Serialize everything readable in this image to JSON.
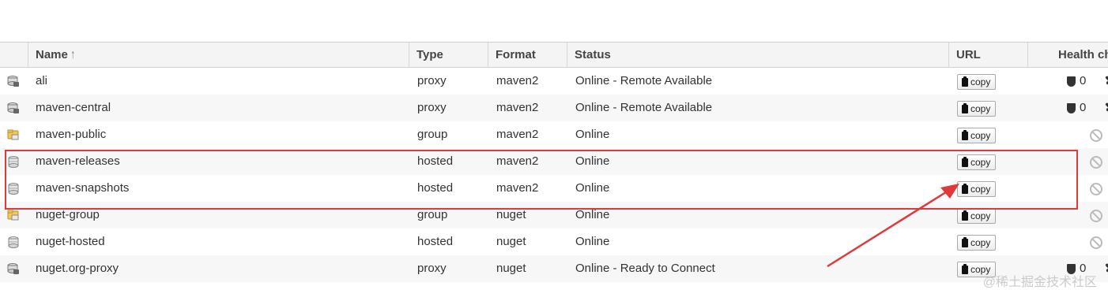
{
  "columns": {
    "name": "Name",
    "type": "Type",
    "format": "Format",
    "status": "Status",
    "url": "URL",
    "health": "Health ch"
  },
  "copy_label": "copy",
  "rows": [
    {
      "name": "ali",
      "type": "proxy",
      "format": "maven2",
      "status": "Online - Remote Available",
      "health": "0",
      "icon": "proxy-repo-icon"
    },
    {
      "name": "maven-central",
      "type": "proxy",
      "format": "maven2",
      "status": "Online - Remote Available",
      "health": "0",
      "icon": "proxy-repo-icon"
    },
    {
      "name": "maven-public",
      "type": "group",
      "format": "maven2",
      "status": "Online",
      "health": "",
      "icon": "group-repo-icon"
    },
    {
      "name": "maven-releases",
      "type": "hosted",
      "format": "maven2",
      "status": "Online",
      "health": "",
      "icon": "hosted-repo-icon"
    },
    {
      "name": "maven-snapshots",
      "type": "hosted",
      "format": "maven2",
      "status": "Online",
      "health": "",
      "icon": "hosted-repo-icon"
    },
    {
      "name": "nuget-group",
      "type": "group",
      "format": "nuget",
      "status": "Online",
      "health": "",
      "icon": "group-repo-icon"
    },
    {
      "name": "nuget-hosted",
      "type": "hosted",
      "format": "nuget",
      "status": "Online",
      "health": "",
      "icon": "hosted-repo-icon"
    },
    {
      "name": "nuget.org-proxy",
      "type": "proxy",
      "format": "nuget",
      "status": "Online - Ready to Connect",
      "health": "0",
      "icon": "proxy-repo-icon"
    }
  ],
  "annotation": {
    "color": "#e0393b"
  },
  "watermark": "@稀土掘金技术社区"
}
